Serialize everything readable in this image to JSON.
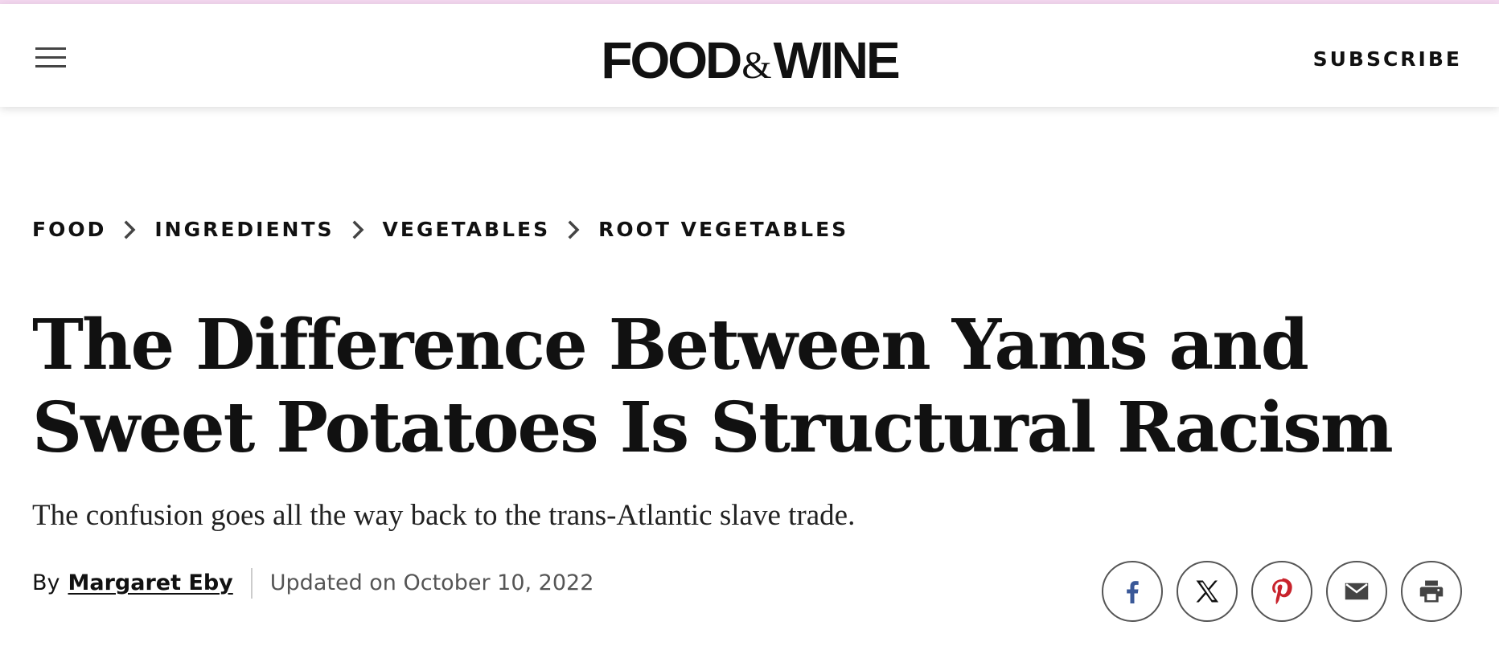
{
  "header": {
    "logo_left": "FOOD",
    "logo_amp": "&",
    "logo_right": "WINE",
    "subscribe_label": "SUBSCRIBE"
  },
  "breadcrumb": [
    {
      "label": "FOOD"
    },
    {
      "label": "INGREDIENTS"
    },
    {
      "label": "VEGETABLES"
    },
    {
      "label": "ROOT VEGETABLES"
    }
  ],
  "article": {
    "title": "The Difference Between Yams and Sweet Potatoes Is Structural Racism",
    "dek": "The confusion goes all the way back to the trans-Atlantic slave trade.",
    "by_prefix": "By",
    "author": "Margaret Eby",
    "updated": "Updated on October 10, 2022"
  },
  "share": [
    {
      "icon": "facebook-icon",
      "color": "#3b5998"
    },
    {
      "icon": "x-twitter-icon",
      "color": "#111111"
    },
    {
      "icon": "pinterest-icon",
      "color": "#c8232c"
    },
    {
      "icon": "email-icon",
      "color": "#444444"
    },
    {
      "icon": "print-icon",
      "color": "#444444"
    }
  ],
  "colors": {
    "top_accent": "#f3d7ef",
    "text": "#111111",
    "muted": "#555555"
  }
}
